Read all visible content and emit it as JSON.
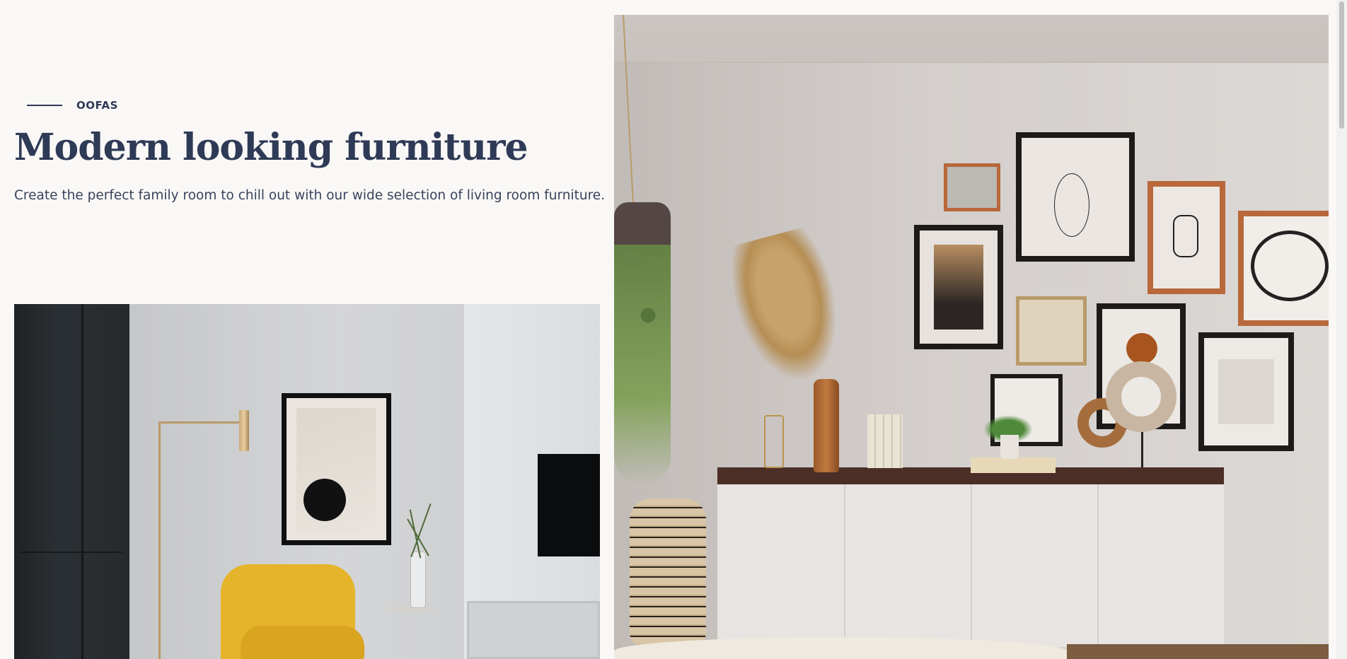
{
  "hero": {
    "eyebrow": "OOFAS",
    "title": "Modern looking furniture",
    "subtitle": "Create the perfect family room to chill out with our wide selection of living room furniture."
  },
  "colors": {
    "background": "#faf8f6",
    "text": "#2e3a56"
  },
  "icons": {
    "eyebrow_divider": "horizontal-line"
  }
}
